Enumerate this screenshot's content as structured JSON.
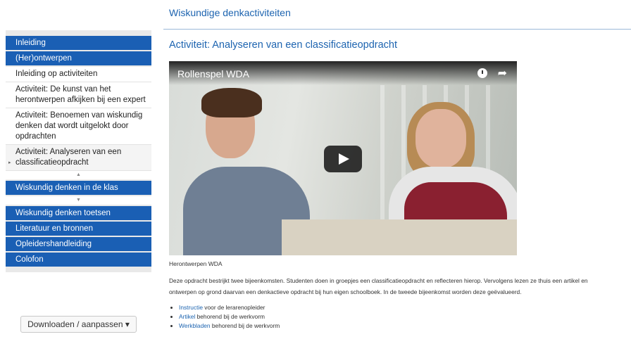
{
  "header": {
    "site_title": "Wiskundige denkactiviteiten"
  },
  "sidebar": {
    "top_items": [
      "Inleiding",
      "(Her)ontwerpen"
    ],
    "sub_items": [
      "Inleiding op activiteiten",
      "Activiteit: De kunst van het herontwerpen afkijken bij een expert",
      "Activiteit: Benoemen van wiskundig denken dat wordt uitgelokt door opdrachten",
      "Activiteit: Analyseren van een classificatieopdracht"
    ],
    "scroll_up_icon": "up-arrow-icon",
    "scroll_down_icon": "down-arrow-icon",
    "middle_item": "Wiskundig denken in de klas",
    "bottom_items": [
      "Wiskundig denken toetsen",
      "Literatuur en bronnen",
      "Opleidershandleiding",
      "Colofon"
    ],
    "download_label": "Downloaden / aanpassen ▾"
  },
  "main": {
    "heading": "Activiteit: Analyseren van een classificatieopdracht",
    "video": {
      "title": "Rollenspel WDA"
    },
    "caption": "Herontwerpen WDA",
    "description_line1": "Deze opdracht bestrijkt twee bijeenkomsten. Studenten doen in groepjes een classificatieopdracht en reflecteren hierop. Vervolgens lezen ze thuis een artikel en",
    "description_line2": "ontwerpen op grond daarvan een denkactieve opdracht bij hun eigen schoolboek. In de tweede bijeenkomst worden deze geëvalueerd.",
    "links": [
      {
        "link": "Instructie",
        "rest": " voor de lerarenopleider"
      },
      {
        "link": "Artikel",
        "rest": " behorend bij de werkvorm"
      },
      {
        "link": "Werkbladen",
        "rest": " behorend bij de werkvorm"
      }
    ]
  },
  "colors": {
    "accent": "#1a5fb4",
    "sidebar_bg": "#e9e9e9"
  }
}
